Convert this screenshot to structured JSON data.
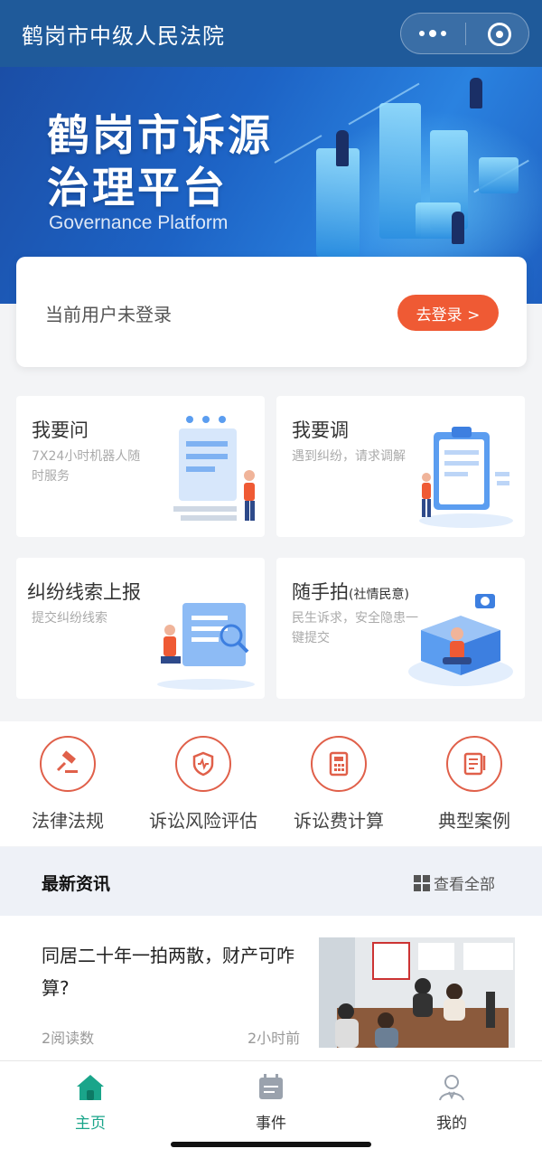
{
  "header": {
    "title": "鹤岗市中级人民法院"
  },
  "banner": {
    "title_line1": "鹤岗市诉源",
    "title_line2": "治理平台",
    "subtitle": "Governance Platform"
  },
  "login": {
    "status_text": "当前用户未登录",
    "button_label": "去登录 >"
  },
  "services": [
    {
      "title": "我要问",
      "title_suffix": "",
      "desc": "7X24小时机器人随时服务"
    },
    {
      "title": "我要调",
      "title_suffix": "",
      "desc": "遇到纠纷，请求调解"
    },
    {
      "title": "纠纷线索上报",
      "title_suffix": "",
      "desc": "提交纠纷线索"
    },
    {
      "title": "随手拍",
      "title_suffix": "(社情民意)",
      "desc": "民生诉求，安全隐患一键提交"
    }
  ],
  "tools": [
    {
      "label": "法律法规",
      "icon": "gavel-icon"
    },
    {
      "label": "诉讼风险评估",
      "icon": "shield-icon"
    },
    {
      "label": "诉讼费计算",
      "icon": "calculator-icon"
    },
    {
      "label": "典型案例",
      "icon": "document-list-icon"
    }
  ],
  "news": {
    "section_title": "最新资讯",
    "view_all_label": "查看全部",
    "items": [
      {
        "title": "同居二十年一拍两散，财产可咋算?",
        "reads": "2阅读数",
        "time": "2小时前"
      }
    ]
  },
  "tabbar": {
    "items": [
      {
        "label": "主页",
        "icon": "home-icon",
        "active": true
      },
      {
        "label": "事件",
        "icon": "calendar-icon",
        "active": false
      },
      {
        "label": "我的",
        "icon": "user-icon",
        "active": false
      }
    ]
  },
  "colors": {
    "header_bg": "#1f5a9a",
    "accent": "#ef5a34",
    "tool_icon": "#e0604a",
    "active_tab": "#1aa58a"
  }
}
